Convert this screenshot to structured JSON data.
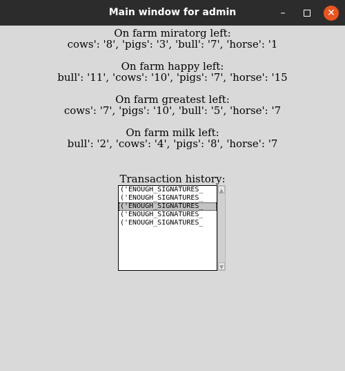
{
  "window": {
    "title": "Main window for admin",
    "min_glyph": "–",
    "close_glyph": "✕"
  },
  "farms": [
    {
      "heading": "On farm miratorg left:",
      "stock": "cows': '8', 'pigs': '3', 'bull': '7', 'horse': '1"
    },
    {
      "heading": "On farm happy left:",
      "stock": "bull': '11', 'cows': '10', 'pigs': '7', 'horse': '15"
    },
    {
      "heading": "On farm greatest left:",
      "stock": "cows': '7', 'pigs': '10', 'bull': '5', 'horse': '7"
    },
    {
      "heading": "On farm milk left:",
      "stock": "bull': '2', 'cows': '4', 'pigs': '8', 'horse': '7"
    }
  ],
  "history": {
    "label": "Transaction history:",
    "items": [
      "('ENOUGH_SIGNATURES_",
      "('ENOUGH_SIGNATURES_",
      "('ENOUGH_SIGNATURES_",
      "('ENOUGH_SIGNATURES_",
      "('ENOUGH_SIGNATURES_"
    ],
    "selected_index": 2,
    "scroll_up_glyph": "▲",
    "scroll_down_glyph": "▼"
  }
}
